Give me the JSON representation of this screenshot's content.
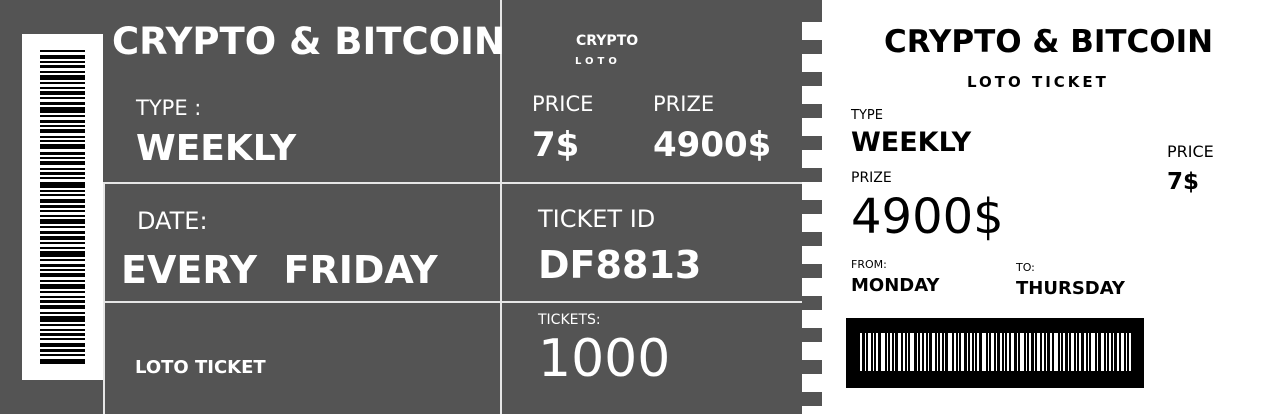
{
  "main": {
    "title": "CRYPTO & BITCOIN",
    "type_label": "TYPE :",
    "type_value": "WEEKLY",
    "date_label": "DATE:",
    "date_value": "EVERY  FRIDAY",
    "footer_label": "LOTO TICKET",
    "brand_name": "CRYPTO",
    "brand_sub": "LOTO",
    "price_label": "PRICE",
    "price_value": "7$",
    "prize_label": "PRIZE",
    "prize_value": "4900$",
    "ticket_id_label": "TICKET ID",
    "ticket_id_value": "DF8813",
    "tickets_label": "TICKETS:",
    "tickets_value": "1000"
  },
  "stub": {
    "title": "CRYPTO & BITCOIN",
    "subtitle": "LOTO TICKET",
    "type_label": "TYPE",
    "type_value": "WEEKLY",
    "price_label": "PRICE",
    "price_value": "7$",
    "prize_label": "PRIZE",
    "prize_value": "4900$",
    "from_label": "FROM:",
    "from_value": "MONDAY",
    "to_label": "TO:",
    "to_value": "THURSDAY"
  },
  "colors": {
    "panel": "#545454",
    "divider": "#e6e6e6",
    "stub_background": "#ffffff",
    "ink": "#000000"
  },
  "icons": [
    "vertical-barcode-icon",
    "horizontal-barcode-icon"
  ]
}
